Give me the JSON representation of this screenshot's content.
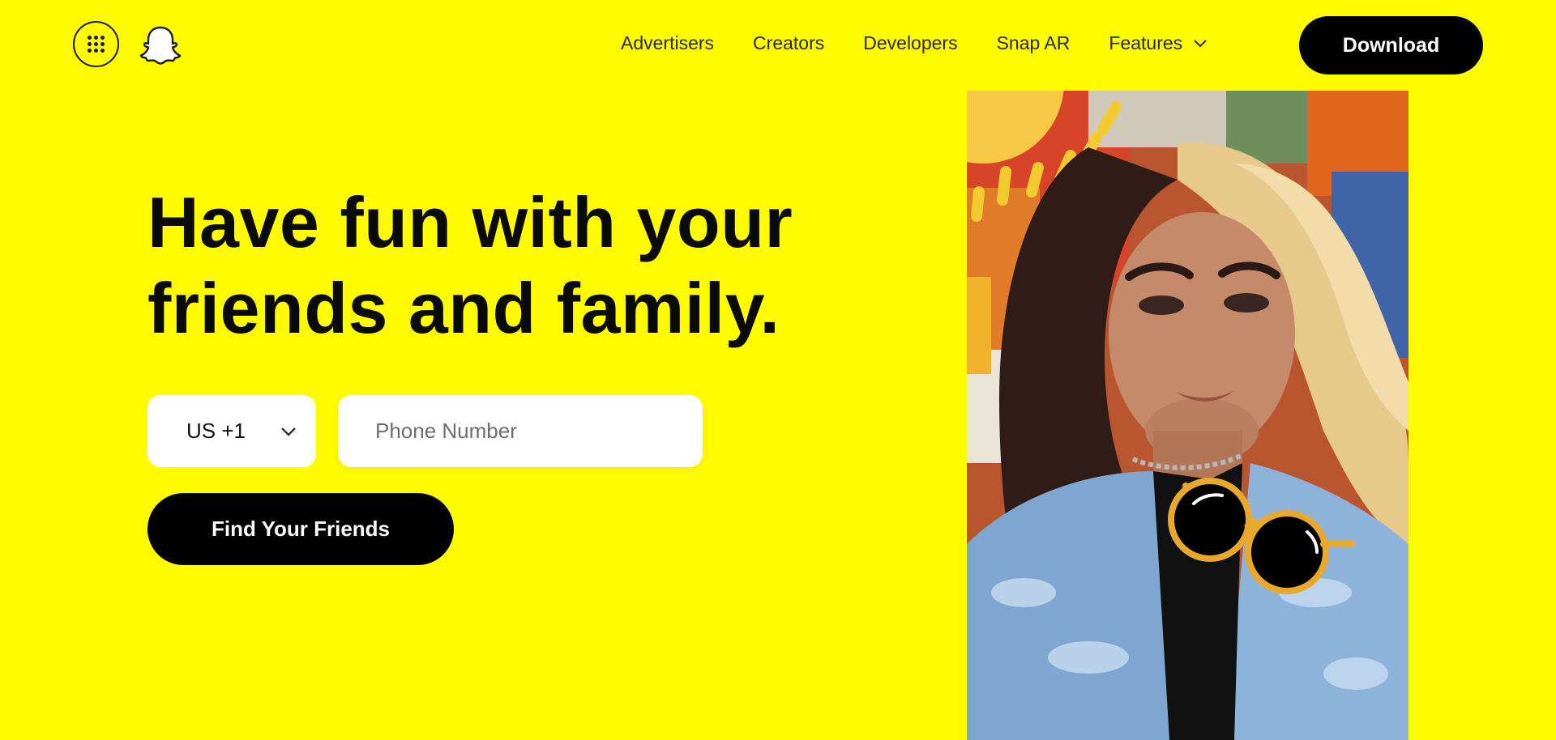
{
  "brand": {
    "accent": "#FFFC00",
    "dark": "#000000"
  },
  "header": {
    "menu_icon": "grid-icon",
    "logo_icon": "ghost-logo-icon",
    "nav": [
      {
        "label": "Advertisers"
      },
      {
        "label": "Creators"
      },
      {
        "label": "Developers"
      },
      {
        "label": "Snap AR"
      },
      {
        "label": "Features",
        "icon": "chevron-down-icon"
      }
    ],
    "download_label": "Download"
  },
  "hero": {
    "headline_line1": "Have fun with your",
    "headline_line2": "friends and family.",
    "country_code": "US +1",
    "phone_placeholder": "Phone Number",
    "cta_label": "Find Your Friends",
    "image": "selfie-with-sunglasses-lens-image"
  }
}
